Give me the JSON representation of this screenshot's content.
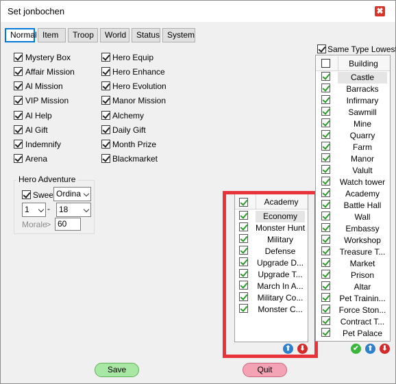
{
  "window": {
    "title": "Set jonbochen",
    "close_glyph": "✖"
  },
  "tabs": [
    "Normal",
    "Item",
    "Troop",
    "World",
    "Status",
    "System"
  ],
  "options_left": [
    "Mystery Box",
    "Affair Mission",
    "Al Mission",
    "VIP Mission",
    "Al Help",
    "Al Gift",
    "Indemnify",
    "Arena"
  ],
  "options_right": [
    "Hero Equip",
    "Hero Enhance",
    "Hero Evolution",
    "Manor Mission",
    "Alchemy",
    "Daily Gift",
    "Month Prize",
    "Blackmarket"
  ],
  "hero_adventure": {
    "title": "Hero Adventure",
    "sweep_label": "Sweep",
    "mode_value": "Ordina",
    "from_value": "1",
    "dash": "-",
    "to_value": "18",
    "morale_label": "Morale",
    "morale_op": ">",
    "morale_value": "60"
  },
  "academy_list": {
    "header": "Academy",
    "items": [
      "Economy",
      "Monster Hunt",
      "Military",
      "Defense",
      "Upgrade D...",
      "Upgrade T...",
      "March In A...",
      "Military Co...",
      "Monster C..."
    ]
  },
  "building_list": {
    "same_type_label": "Same Type Lowest",
    "header": "Building",
    "items": [
      "Castle",
      "Barracks",
      "Infirmary",
      "Sawmill",
      "Mine",
      "Quarry",
      "Farm",
      "Manor",
      "Valult",
      "Watch tower",
      "Academy",
      "Battle Hall",
      "Wall",
      "Embassy",
      "Workshop",
      "Treasure T...",
      "Market",
      "Prison",
      "Altar",
      "Pet Trainin...",
      "Force Ston...",
      "Contract T...",
      "Pet Palace"
    ]
  },
  "move_icons": {
    "up": "⬆",
    "down": "⬇",
    "ok": "✔"
  },
  "buttons": {
    "save": "Save",
    "quit": "Quit"
  },
  "colors": {
    "highlight": "#e8333a",
    "save_bg": "#a9e7a5",
    "quit_bg": "#f4a3b4",
    "up_icon": "#2f7fc9",
    "down_icon": "#d42a2a",
    "ok_icon": "#3cb53c"
  }
}
